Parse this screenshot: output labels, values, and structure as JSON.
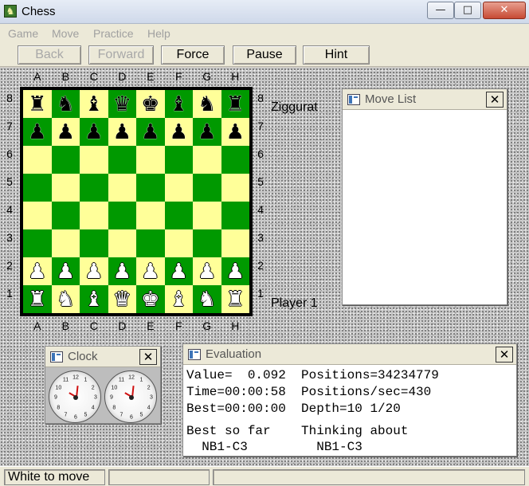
{
  "window": {
    "title": "Chess",
    "minimize_glyph": "—",
    "maximize_glyph": "□",
    "close_glyph": "✕"
  },
  "menu": {
    "items": [
      "Game",
      "Move",
      "Practice",
      "Help"
    ]
  },
  "toolbar": {
    "buttons": [
      {
        "label": "Back",
        "enabled": false
      },
      {
        "label": "Forward",
        "enabled": false
      },
      {
        "label": "Force",
        "enabled": true
      },
      {
        "label": "Pause",
        "enabled": true
      },
      {
        "label": "Hint",
        "enabled": true
      }
    ]
  },
  "board": {
    "files": [
      "A",
      "B",
      "C",
      "D",
      "E",
      "F",
      "G",
      "H"
    ],
    "ranks": [
      "8",
      "7",
      "6",
      "5",
      "4",
      "3",
      "2",
      "1"
    ],
    "colors": {
      "light": "#ffff99",
      "dark": "#009900"
    },
    "rows": [
      [
        "♜",
        "♞",
        "♝",
        "♛",
        "♚",
        "♝",
        "♞",
        "♜"
      ],
      [
        "♟",
        "♟",
        "♟",
        "♟",
        "♟",
        "♟",
        "♟",
        "♟"
      ],
      [
        "",
        "",
        "",
        "",
        "",
        "",
        "",
        ""
      ],
      [
        "",
        "",
        "",
        "",
        "",
        "",
        "",
        ""
      ],
      [
        "",
        "",
        "",
        "",
        "",
        "",
        "",
        ""
      ],
      [
        "",
        "",
        "",
        "",
        "",
        "",
        "",
        ""
      ],
      [
        "♟",
        "♟",
        "♟",
        "♟",
        "♟",
        "♟",
        "♟",
        "♟"
      ],
      [
        "♜",
        "♞",
        "♝",
        "♛",
        "♚",
        "♝",
        "♞",
        "♜"
      ]
    ],
    "piece_colors": [
      "black",
      "black",
      "",
      "",
      "",
      "",
      "white",
      "white"
    ]
  },
  "players": {
    "top": "Ziggurat",
    "bottom": "Player 1"
  },
  "move_list": {
    "title": "Move List",
    "close_glyph": "✕"
  },
  "clock": {
    "title": "Clock",
    "close_glyph": "✕",
    "numbers": [
      "12",
      "1",
      "2",
      "3",
      "4",
      "5",
      "6",
      "7",
      "8",
      "9",
      "10",
      "11"
    ]
  },
  "evaluation": {
    "title": "Evaluation",
    "close_glyph": "✕",
    "lines": [
      "Value=  0.092  Positions=34234779",
      "Time=00:00:58  Positions/sec=430",
      "Best=00:00:00  Depth=10 1/20",
      "",
      "Best so far    Thinking about",
      "  NB1-C3         NB1-C3"
    ]
  },
  "status": {
    "text": "White to move",
    "cell2": "",
    "cell3": ""
  }
}
